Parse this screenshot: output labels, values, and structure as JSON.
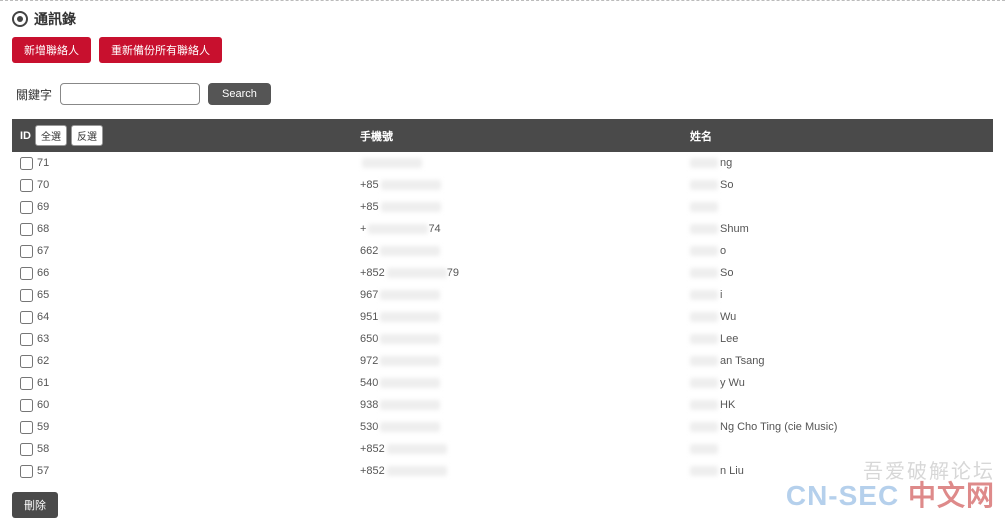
{
  "header": {
    "title": "通訊錄"
  },
  "actions": {
    "add_contact": "新增聯絡人",
    "rebackup_all": "重新備份所有聯絡人"
  },
  "search": {
    "label": "關鍵字",
    "placeholder": "",
    "button": "Search"
  },
  "table": {
    "headers": {
      "id": "ID",
      "select_all": "全選",
      "invert": "反選",
      "phone": "手機號",
      "name": "姓名"
    },
    "rows": [
      {
        "id": "71",
        "phone_prefix": "",
        "name_suffix": "ng"
      },
      {
        "id": "70",
        "phone_prefix": "+85",
        "name_suffix": "So"
      },
      {
        "id": "69",
        "phone_prefix": "+85",
        "name_suffix": ""
      },
      {
        "id": "68",
        "phone_prefix": "+",
        "phone_suffix": "74",
        "name_suffix": "Shum"
      },
      {
        "id": "67",
        "phone_prefix": "662",
        "name_suffix": "o"
      },
      {
        "id": "66",
        "phone_prefix": "+852",
        "phone_suffix": "79",
        "name_suffix": "So"
      },
      {
        "id": "65",
        "phone_prefix": "967",
        "name_suffix": "i"
      },
      {
        "id": "64",
        "phone_prefix": "951",
        "name_suffix": "Wu"
      },
      {
        "id": "63",
        "phone_prefix": "650",
        "name_suffix": "Lee"
      },
      {
        "id": "62",
        "phone_prefix": "972",
        "name_suffix": "an Tsang"
      },
      {
        "id": "61",
        "phone_prefix": "540",
        "name_suffix": "y Wu"
      },
      {
        "id": "60",
        "phone_prefix": "938",
        "name_suffix": "HK"
      },
      {
        "id": "59",
        "phone_prefix": "530",
        "name_suffix": "Ng Cho Ting (cie Music)"
      },
      {
        "id": "58",
        "phone_prefix": "+852",
        "name_suffix": ""
      },
      {
        "id": "57",
        "phone_prefix": "+852",
        "name_suffix": "n Liu"
      }
    ]
  },
  "footer": {
    "delete": "刪除"
  },
  "watermarks": {
    "top": "吾爱破解论坛",
    "bottom_left": "CN-SEC",
    "bottom_right": "中文网"
  }
}
